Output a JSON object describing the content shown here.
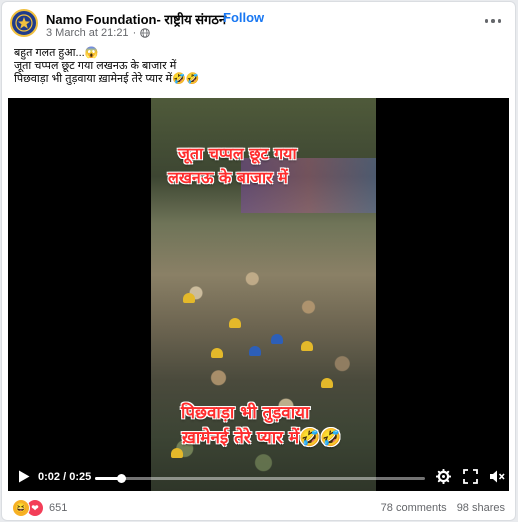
{
  "post": {
    "page_name": "Namo Foundation- राष्ट्रीय संगठन",
    "separator": "·",
    "follow_label": "Follow",
    "timestamp": "3 March at 21:21",
    "meta_separator": "·",
    "privacy_icon": "globe-icon",
    "caption_lines": [
      "बहुत गलत हुआ...😱",
      "जूता चप्पल छूट गया लखनऊ के बाजार में",
      "पिछवाड़ा भी तुड़वाया ख़ामेनई तेरे प्यार में🤣🤣"
    ]
  },
  "video": {
    "overlay_top": [
      "जूता चप्पल छूट गया",
      "लखनऊ के बाजार में"
    ],
    "overlay_bottom": [
      "पिछवाड़ा भी तुड़वाया",
      "ख़ामेनई तेरे प्यार में🤣🤣"
    ],
    "current_time": "0:02",
    "duration": "0:25",
    "progress": 0.08,
    "controls": [
      "play-icon",
      "settings-icon",
      "fullscreen-icon",
      "volume-muted-icon"
    ]
  },
  "footer": {
    "reactions": [
      "haha",
      "love"
    ],
    "reaction_count": "651",
    "comments": "78 comments",
    "shares": "98 shares"
  },
  "colors": {
    "accent": "#1877f2",
    "overlay_text": "#ff2d2d",
    "secondary_text": "#65676b"
  }
}
